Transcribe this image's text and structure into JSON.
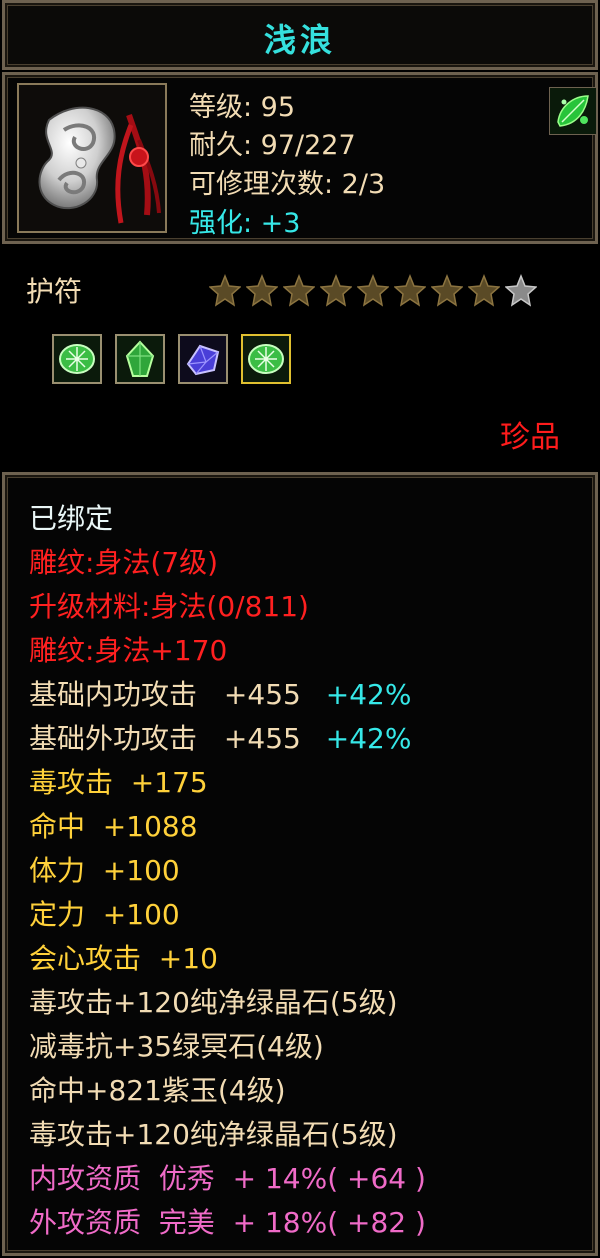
{
  "item": {
    "name": "浅浪",
    "type": "护符",
    "quality": "珍品",
    "stats": {
      "level": "等级: 95",
      "durability": "耐久: 97/227",
      "repair_count": "可修理次数: 2/3",
      "enhance": "强化: +3"
    },
    "stars": {
      "total": 9,
      "filled": 8
    },
    "gems": [
      {
        "icon": "green-crystal-gem-icon"
      },
      {
        "icon": "green-jade-gem-icon"
      },
      {
        "icon": "purple-jade-gem-icon"
      },
      {
        "icon": "green-crystal-gem-icon"
      }
    ]
  },
  "attributes": {
    "bound": "已绑定",
    "engrave_1": "雕纹:身法(7级)",
    "upgrade_material": "升级材料:身法(0/811)",
    "engrave_2": "雕纹:身法+170",
    "base_inner_attack": {
      "label": "基础内功攻击",
      "value": "+455",
      "bonus": "+42%"
    },
    "base_outer_attack": {
      "label": "基础外功攻击",
      "value": "+455",
      "bonus": "+42%"
    },
    "poison_attack": "毒攻击  +175",
    "hit": "命中  +1088",
    "stamina": "体力  +100",
    "focus": "定力  +100",
    "crit_attack": "会心攻击  +10",
    "gem_line_1": "毒攻击+120纯净绿晶石(5级)",
    "gem_line_2": "减毒抗+35绿冥石(4级)",
    "gem_line_3": "命中+821紫玉(4级)",
    "gem_line_4": "毒攻击+120纯净绿晶石(5级)",
    "inner_aptitude": "内攻资质  优秀  + 14%( +64 )",
    "outer_aptitude": "外攻资质  完美  + 18%( +82 )"
  },
  "colors": {
    "title": "#35e0dd",
    "engrave": "#ff2020",
    "quality": "#ff1c1c",
    "aptitude": "#f06bc8",
    "base_stat": "#f2dcb4",
    "bonus_stat": "#ffd13a",
    "percent": "#36e8e8"
  }
}
